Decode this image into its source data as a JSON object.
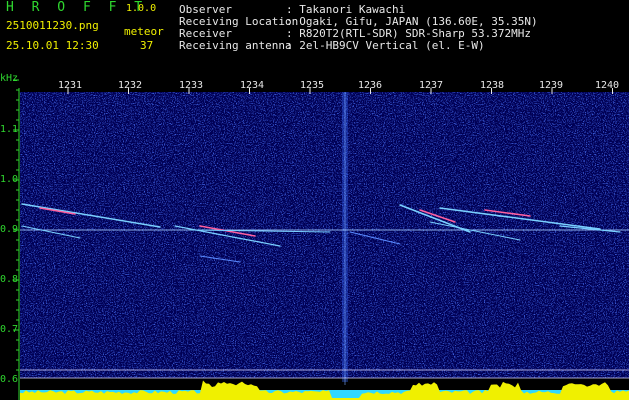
{
  "app": {
    "name": "H R O F F T",
    "version": "1.0.0",
    "filename": "2510011230.png",
    "datetime": "25.10.01 12:30",
    "type_label": "meteor",
    "count": "37"
  },
  "header": [
    {
      "key": "Observer",
      "value": ": Takanori Kawachi"
    },
    {
      "key": "Receiving Location",
      "value": ": Ogaki, Gifu, JAPAN (136.60E, 35.35N)"
    },
    {
      "key": "Receiver",
      "value": ": R820T2(RTL-SDR) SDR-Sharp 53.372MHz"
    },
    {
      "key": "Receiving antenna",
      "value": ": 2el-HB9CV Vertical (el. E-W)"
    }
  ],
  "chart_data": {
    "type": "spectrogram",
    "y_unit": "kHz",
    "y_ticks": [
      "1.1",
      "1.0",
      "0.9",
      "0.8",
      "0.7",
      "0.6"
    ],
    "x_ticks": [
      "1231",
      "1232",
      "1233",
      "1234",
      "1235",
      "1236",
      "1237",
      "1238",
      "1239",
      "1240"
    ],
    "colors": {
      "axis": "#2fd82f",
      "noise": "#10209a",
      "trace_main": "#7ad0ff",
      "trace_hot": "#ff60a0",
      "hline": "#a0c8ff",
      "baseline": "#f0f000",
      "baseline_low": "#2fd8ff"
    }
  }
}
